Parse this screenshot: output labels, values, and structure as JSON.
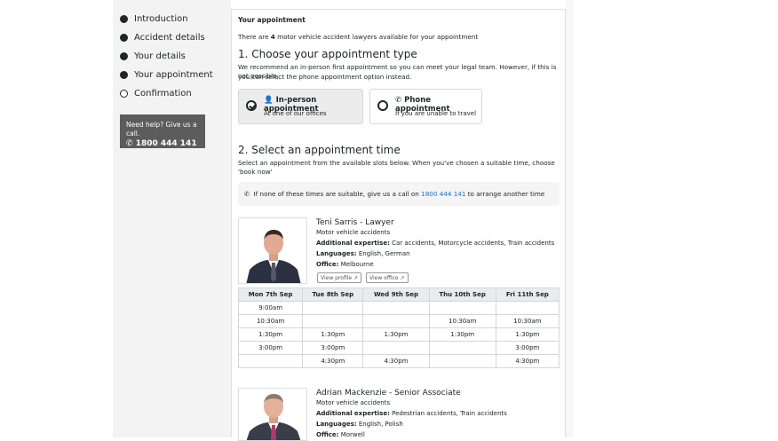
{
  "nav": {
    "items": [
      {
        "label": "Introduction",
        "done": true
      },
      {
        "label": "Accident details",
        "done": true
      },
      {
        "label": "Your details",
        "done": true
      },
      {
        "label": "Your appointment",
        "done": true
      },
      {
        "label": "Confirmation",
        "done": false
      }
    ]
  },
  "help": {
    "line1": "Need help? Give us a call.",
    "phone": "1800 444 141"
  },
  "panel": {
    "title": "Your appointment",
    "avail_pre": "There are ",
    "avail_count": "4",
    "avail_post": " motor vehicle accident lawyers available for your appointment"
  },
  "section1": {
    "heading": "1. Choose your appointment type",
    "desc1": "We recommend an in-person first appointment so you can meet your legal team. However, if this is not possible,",
    "desc2": "you can select the phone appointment option instead.",
    "inperson_title": "In-person appointment",
    "inperson_sub": "At one of our offices",
    "phone_title": "Phone appointment",
    "phone_sub": "If you are unable to travel"
  },
  "section2": {
    "heading": "2. Select an appointment time",
    "desc": "Select an appointment from the available slots below. When you've chosen a suitable time, choose 'book now'",
    "notice_pre": "If none of these times are suitable, give us a call on ",
    "notice_phone": "1800 444 141",
    "notice_post": " to arrange another time"
  },
  "lawyers": [
    {
      "name": "Teni Sarris - Lawyer",
      "area": "Motor vehicle accidents",
      "expertise_label": "Additional expertise:",
      "expertise": " Car accidents, Motorcycle accidents, Train accidents",
      "languages_label": "Languages:",
      "languages": " English, German",
      "office_label": "Office:",
      "office": " Melbourne",
      "view_profile": "View profile",
      "view_office": "View office"
    },
    {
      "name": "Adrian Mackenzie - Senior Associate",
      "area": "Motor vehicle accidents",
      "expertise_label": "Additional expertise:",
      "expertise": " Pedestrian accidents, Train accidents",
      "languages_label": "Languages:",
      "languages": " English, Polish",
      "office_label": "Office:",
      "office": " Morwell"
    }
  ],
  "schedule": {
    "days": [
      "Mon 7th Sep",
      "Tue 8th Sep",
      "Wed 9th Sep",
      "Thu 10th Sep",
      "Fri 11th Sep"
    ],
    "rows": [
      [
        "9:00am",
        "",
        "",
        "",
        ""
      ],
      [
        "10:30am",
        "",
        "",
        "10:30am",
        "10:30am"
      ],
      [
        "1:30pm",
        "1:30pm",
        "1:30pm",
        "1:30pm",
        "1:30pm"
      ],
      [
        "3:00pm",
        "3:00pm",
        "",
        "",
        "3:00pm"
      ],
      [
        "",
        "4:30pm",
        "4:30pm",
        "",
        "4:30pm"
      ]
    ]
  }
}
